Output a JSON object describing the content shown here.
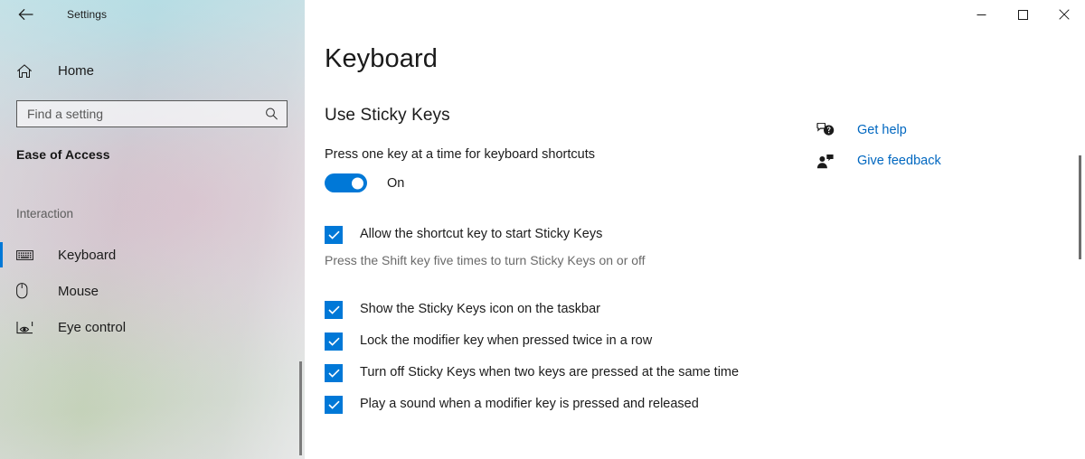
{
  "window": {
    "title": "Settings",
    "back_icon": "back-arrow-icon",
    "minimize_label": "─",
    "maximize_label": "□",
    "close_label": "✕"
  },
  "sidebar": {
    "home_label": "Home",
    "home_icon": "home-icon",
    "search": {
      "placeholder": "Find a setting",
      "value": "",
      "icon": "search-icon"
    },
    "category_title": "Ease of Access",
    "group_label": "Interaction",
    "items": [
      {
        "label": "Keyboard",
        "icon": "keyboard-icon",
        "selected": true
      },
      {
        "label": "Mouse",
        "icon": "mouse-icon",
        "selected": false
      },
      {
        "label": "Eye control",
        "icon": "eye-control-icon",
        "selected": false
      }
    ],
    "accent_color": "#0078d7"
  },
  "main": {
    "page_title": "Keyboard",
    "section_title": "Use Sticky Keys",
    "setting_description": "Press one key at a time for keyboard shortcuts",
    "toggle": {
      "state_label": "On",
      "on": true,
      "color": "#0078d7"
    },
    "group1": [
      {
        "label": "Allow the shortcut key to start Sticky Keys",
        "checked": true,
        "sub_label": "Press the Shift key five times to turn Sticky Keys on or off"
      }
    ],
    "group2": [
      {
        "label": "Show the Sticky Keys icon on the taskbar",
        "checked": true
      },
      {
        "label": "Lock the modifier key when pressed twice in a row",
        "checked": true
      },
      {
        "label": "Turn off Sticky Keys when two keys are pressed at the same time",
        "checked": true
      },
      {
        "label": "Play a sound when a modifier key is pressed and released",
        "checked": true
      }
    ],
    "links": [
      {
        "label": "Get help",
        "icon": "help-question-bubble-icon",
        "color": "#0067c0"
      },
      {
        "label": "Give feedback",
        "icon": "feedback-person-icon",
        "color": "#0067c0"
      }
    ]
  }
}
